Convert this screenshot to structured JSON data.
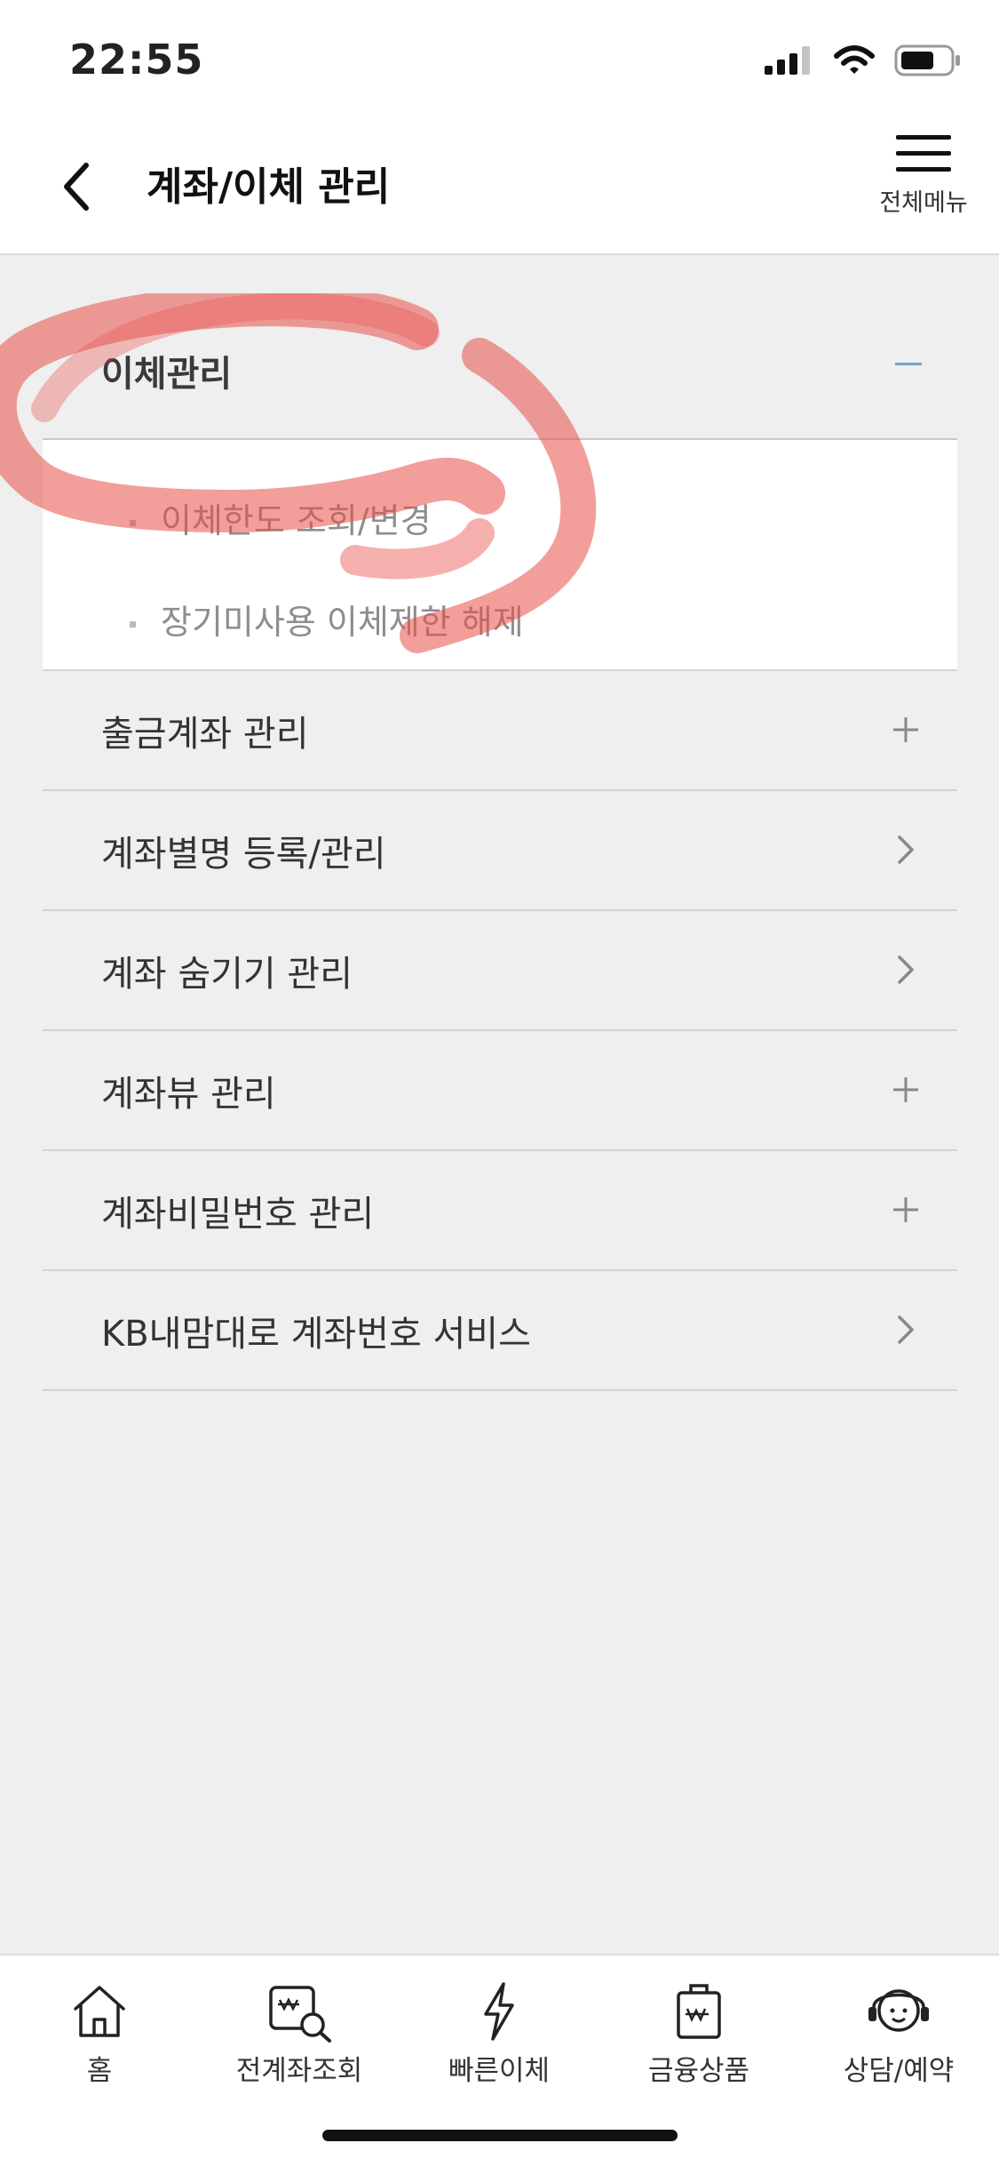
{
  "status_bar": {
    "time": "22:55"
  },
  "header": {
    "title": "계좌/이체 관리",
    "menu_label": "전체메뉴"
  },
  "section": {
    "title": "이체관리",
    "expanded": true,
    "sub_items": [
      {
        "label": "이체한도 조회/변경"
      },
      {
        "label": "장기미사용 이체제한 해제"
      }
    ]
  },
  "rows": [
    {
      "label": "출금계좌 관리",
      "icon": "plus-icon"
    },
    {
      "label": "계좌별명 등록/관리",
      "icon": "chevron-right-icon"
    },
    {
      "label": "계좌 숨기기 관리",
      "icon": "chevron-right-icon"
    },
    {
      "label": "계좌뷰 관리",
      "icon": "plus-icon"
    },
    {
      "label": "계좌비밀번호 관리",
      "icon": "plus-icon"
    },
    {
      "label": "KB내맘대로 계좌번호 서비스",
      "icon": "chevron-right-icon"
    }
  ],
  "tabbar": {
    "tabs": [
      {
        "label": "홈",
        "icon": "home-icon"
      },
      {
        "label": "전계좌조회",
        "icon": "account-search-icon"
      },
      {
        "label": "빠른이체",
        "icon": "lightning-icon"
      },
      {
        "label": "금융상품",
        "icon": "financial-product-icon"
      },
      {
        "label": "상담/예약",
        "icon": "headset-icon"
      }
    ]
  },
  "colors": {
    "annotation": "#e8504a",
    "section_toggle": "#7aa3c8",
    "background": "#efefef"
  }
}
